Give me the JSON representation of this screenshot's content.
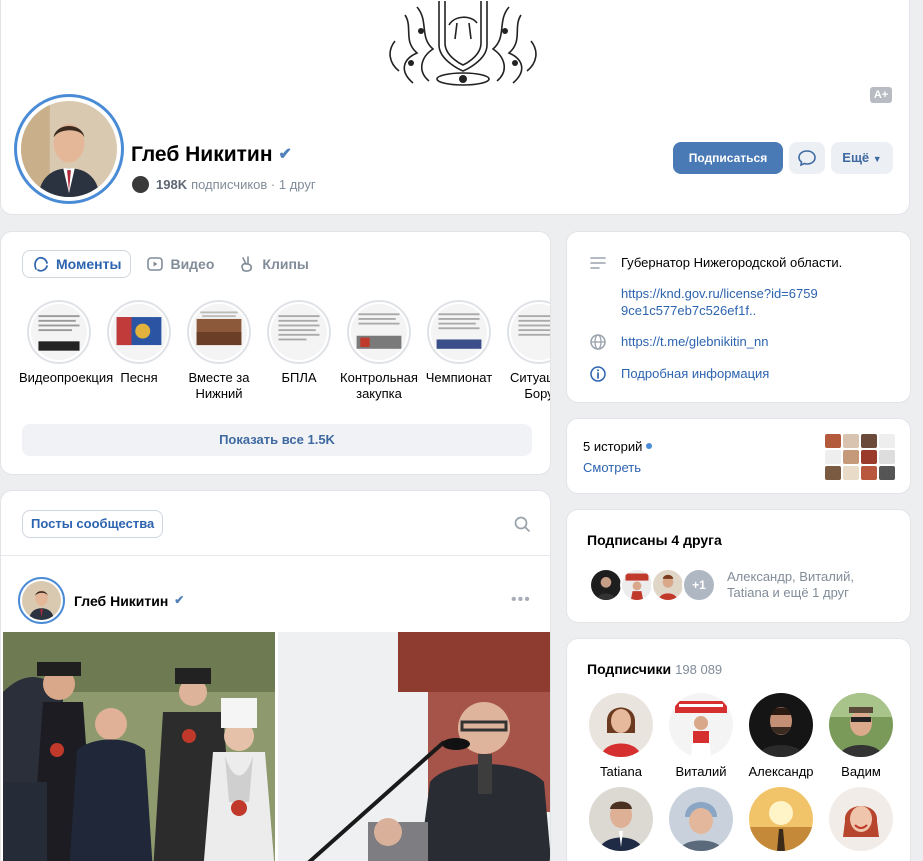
{
  "header": {
    "name": "Глеб Никитин",
    "subscribers_count": "198K",
    "subscribers_rest": "подписчиков · 1 друг",
    "text_size_badge": "A+",
    "subscribe_button": "Подписаться",
    "more_button": "Ещё"
  },
  "moments": {
    "tabs": [
      {
        "label": "Моменты",
        "icon": "moments-icon",
        "active": true
      },
      {
        "label": "Видео",
        "icon": "video-icon",
        "active": false
      },
      {
        "label": "Клипы",
        "icon": "clips-icon",
        "active": false
      }
    ],
    "stories": [
      {
        "label": "Видеопроекция"
      },
      {
        "label": "Песня"
      },
      {
        "label": "Вместе за Нижний"
      },
      {
        "label": "БПЛА"
      },
      {
        "label": "Контрольная закупка"
      },
      {
        "label": "Чемпионат"
      },
      {
        "label": "Ситуация Бору"
      }
    ],
    "show_all": "Показать все 1.5K"
  },
  "posts": {
    "filter_label": "Посты сообщества",
    "author": "Глеб Никитин"
  },
  "info": {
    "description": "Губернатор Нижегородской области.",
    "license_link": "https://knd.gov.ru/license?id=67599ce1c577eb7c526ef1f..",
    "website": "https://t.me/glebnikitin_nn",
    "details_link": "Подробная информация"
  },
  "stories_box": {
    "count_label": "5 историй",
    "watch_label": "Смотреть"
  },
  "friends": {
    "title": "Подписаны 4 друга",
    "plus_label": "+1",
    "names_line1": "Александр, Виталий,",
    "names_line2": "Tatiana и ещё 1 друг"
  },
  "followers": {
    "title": "Подписчики",
    "count": "198 089",
    "items": [
      {
        "name": "Tatiana"
      },
      {
        "name": "Виталий"
      },
      {
        "name": "Александр"
      },
      {
        "name": "Вадим"
      },
      {
        "name": ""
      },
      {
        "name": ""
      },
      {
        "name": ""
      },
      {
        "name": ""
      }
    ]
  },
  "colors": {
    "accent": "#4a7ab6",
    "link": "#2d64b0",
    "avatar_ring": "#4a8bd6",
    "background": "#edeef0"
  }
}
